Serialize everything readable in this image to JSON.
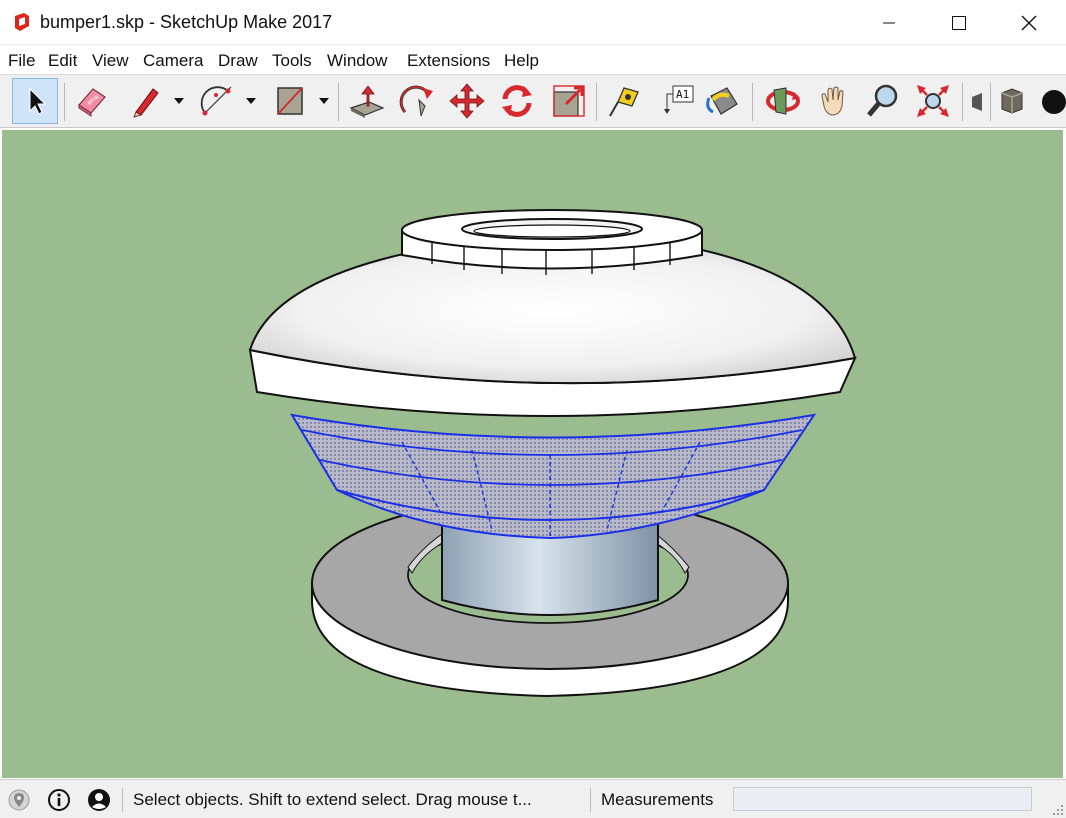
{
  "window": {
    "title": "bumper1.skp - SketchUp Make 2017"
  },
  "menu": [
    "File",
    "Edit",
    "View",
    "Camera",
    "Draw",
    "Tools",
    "Window",
    "Extensions",
    "Help"
  ],
  "toolbar": {
    "tools": [
      {
        "name": "select-tool",
        "icon": "arrow-cursor-icon",
        "active": true
      },
      {
        "name": "eraser-tool",
        "icon": "eraser-icon"
      },
      {
        "name": "line-tool",
        "icon": "pencil-icon",
        "dropdown": true
      },
      {
        "name": "arc-tool",
        "icon": "arc-icon",
        "dropdown": true
      },
      {
        "name": "rectangle-tool",
        "icon": "rectangle-icon",
        "dropdown": true
      },
      {
        "name": "push-pull-tool",
        "icon": "push-pull-icon"
      },
      {
        "name": "follow-me-tool",
        "icon": "follow-me-icon"
      },
      {
        "name": "move-tool",
        "icon": "move-icon"
      },
      {
        "name": "rotate-tool",
        "icon": "rotate-icon"
      },
      {
        "name": "scale-tool",
        "icon": "scale-icon"
      },
      {
        "name": "tape-measure-tool",
        "icon": "tape-measure-icon"
      },
      {
        "name": "text-tool",
        "icon": "text-label-icon",
        "label": "A1"
      },
      {
        "name": "paint-bucket-tool",
        "icon": "paint-bucket-icon"
      },
      {
        "name": "orbit-tool",
        "icon": "orbit-icon"
      },
      {
        "name": "pan-tool",
        "icon": "hand-icon"
      },
      {
        "name": "zoom-tool",
        "icon": "magnifier-icon"
      },
      {
        "name": "zoom-extents-tool",
        "icon": "zoom-extents-icon"
      }
    ]
  },
  "status": {
    "hint": "Select objects. Shift to extend select. Drag mouse t...",
    "measurements_label": "Measurements",
    "measurements_value": ""
  },
  "colors": {
    "viewport_bg": "#9bbc8f",
    "selection": "#1a2fe6",
    "active_tool_bg": "#cfe4f8"
  }
}
